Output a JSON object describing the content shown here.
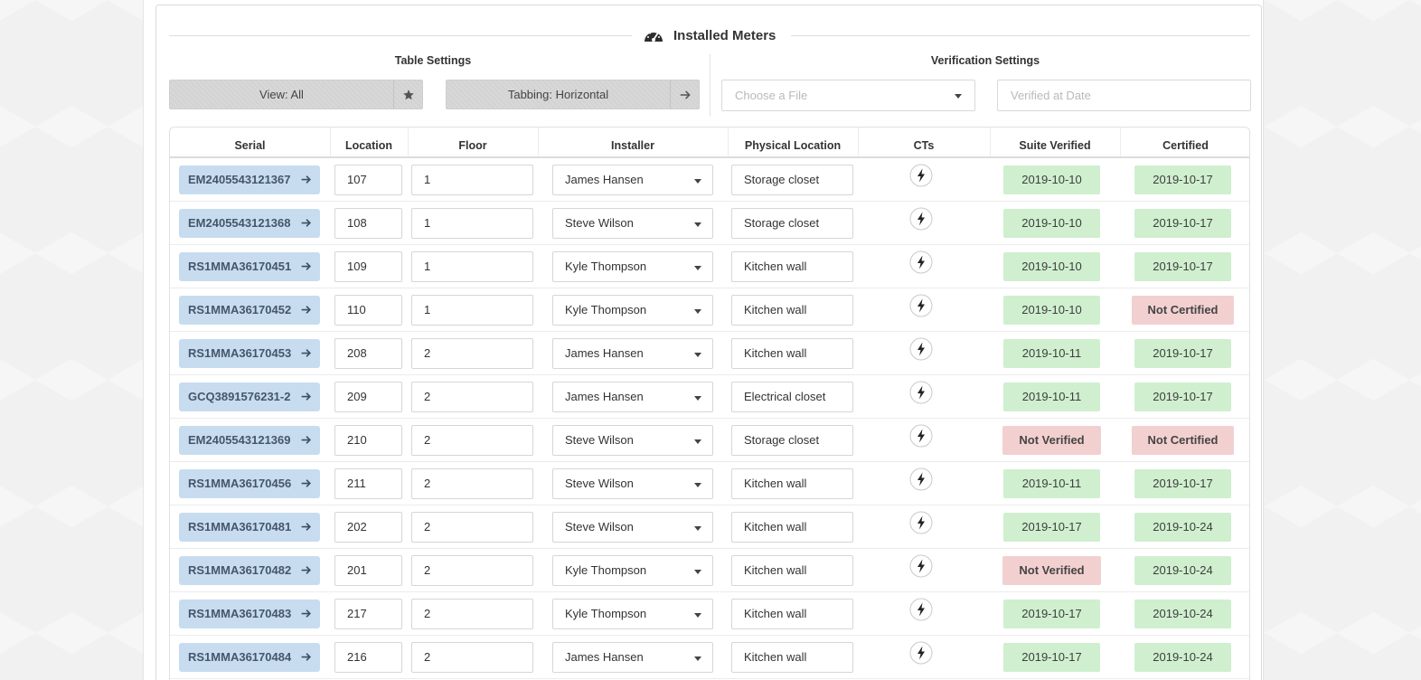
{
  "header": {
    "title": "Installed Meters",
    "title_icon": "gauge-icon"
  },
  "table_settings": {
    "label": "Table Settings",
    "view_button": "View: All",
    "tabbing_button": "Tabbing: Horizontal"
  },
  "verification_settings": {
    "label": "Verification Settings",
    "file_placeholder": "Choose a File",
    "date_placeholder": "Verified at Date"
  },
  "columns": [
    "Serial",
    "Location",
    "Floor",
    "Installer",
    "Physical Location",
    "CTs",
    "Suite Verified",
    "Certified"
  ],
  "rows": [
    {
      "serial": "EM2405543121367",
      "location": "107",
      "floor": "1",
      "installer": "James Hansen",
      "physical_location": "Storage closet",
      "suite_verified": "2019-10-10",
      "suite_ok": true,
      "certified": "2019-10-17",
      "cert_ok": true
    },
    {
      "serial": "EM2405543121368",
      "location": "108",
      "floor": "1",
      "installer": "Steve Wilson",
      "physical_location": "Storage closet",
      "suite_verified": "2019-10-10",
      "suite_ok": true,
      "certified": "2019-10-17",
      "cert_ok": true
    },
    {
      "serial": "RS1MMA36170451",
      "location": "109",
      "floor": "1",
      "installer": "Kyle Thompson",
      "physical_location": "Kitchen wall",
      "suite_verified": "2019-10-10",
      "suite_ok": true,
      "certified": "2019-10-17",
      "cert_ok": true
    },
    {
      "serial": "RS1MMA36170452",
      "location": "110",
      "floor": "1",
      "installer": "Kyle Thompson",
      "physical_location": "Kitchen wall",
      "suite_verified": "2019-10-10",
      "suite_ok": true,
      "certified": "Not Certified",
      "cert_ok": false
    },
    {
      "serial": "RS1MMA36170453",
      "location": "208",
      "floor": "2",
      "installer": "James Hansen",
      "physical_location": "Kitchen wall",
      "suite_verified": "2019-10-11",
      "suite_ok": true,
      "certified": "2019-10-17",
      "cert_ok": true
    },
    {
      "serial": "GCQ3891576231-2",
      "location": "209",
      "floor": "2",
      "installer": "James Hansen",
      "physical_location": "Electrical closet",
      "suite_verified": "2019-10-11",
      "suite_ok": true,
      "certified": "2019-10-17",
      "cert_ok": true
    },
    {
      "serial": "EM2405543121369",
      "location": "210",
      "floor": "2",
      "installer": "Steve Wilson",
      "physical_location": "Storage closet",
      "suite_verified": "Not Verified",
      "suite_ok": false,
      "certified": "Not Certified",
      "cert_ok": false
    },
    {
      "serial": "RS1MMA36170456",
      "location": "211",
      "floor": "2",
      "installer": "Steve Wilson",
      "physical_location": "Kitchen wall",
      "suite_verified": "2019-10-11",
      "suite_ok": true,
      "certified": "2019-10-17",
      "cert_ok": true
    },
    {
      "serial": "RS1MMA36170481",
      "location": "202",
      "floor": "2",
      "installer": "Steve Wilson",
      "physical_location": "Kitchen wall",
      "suite_verified": "2019-10-17",
      "suite_ok": true,
      "certified": "2019-10-24",
      "cert_ok": true
    },
    {
      "serial": "RS1MMA36170482",
      "location": "201",
      "floor": "2",
      "installer": "Kyle Thompson",
      "physical_location": "Kitchen wall",
      "suite_verified": "Not Verified",
      "suite_ok": false,
      "certified": "2019-10-24",
      "cert_ok": true
    },
    {
      "serial": "RS1MMA36170483",
      "location": "217",
      "floor": "2",
      "installer": "Kyle Thompson",
      "physical_location": "Kitchen wall",
      "suite_verified": "2019-10-17",
      "suite_ok": true,
      "certified": "2019-10-24",
      "cert_ok": true
    },
    {
      "serial": "RS1MMA36170484",
      "location": "216",
      "floor": "2",
      "installer": "James Hansen",
      "physical_location": "Kitchen wall",
      "suite_verified": "2019-10-17",
      "suite_ok": true,
      "certified": "2019-10-24",
      "cert_ok": true
    }
  ],
  "icons": {
    "serial_action": "arrow-right-icon",
    "cts": "lightning-bolt-icon",
    "view": "star-icon",
    "tabbing": "arrow-right-icon",
    "dropdown": "caret-down-icon"
  },
  "colors": {
    "serial_badge": "#c8dcf0",
    "verified": "#cfefcf",
    "not_verified": "#f3d0d0"
  }
}
